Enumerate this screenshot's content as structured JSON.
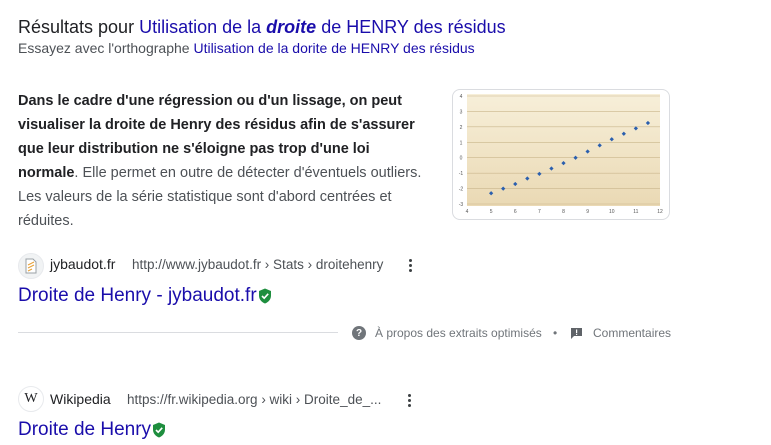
{
  "spelling": {
    "prefix": "Résultats pour",
    "query_part1": "Utilisation de la",
    "query_em": "droite",
    "query_part2": "de HENRY des résidus",
    "suggest_prefix": "Essayez avec l'orthographe",
    "suggest_link": "Utilisation de la dorite de HENRY des résidus"
  },
  "featured_snippet": {
    "bold_text": "Dans le cadre d'une régression ou d'un lissage, on peut visualiser la droite de Henry des résidus afin de s'assurer que leur distribution ne s'éloigne pas trop d'une loi normale",
    "rest_text": ". Elle permet en outre de détecter d'éventuels outliers. Les valeurs de la série statistique sont d'abord centrées et réduites.",
    "thumbnail": {
      "x_ticks": [
        "4",
        "5",
        "6",
        "7",
        "8",
        "9",
        "10",
        "11",
        "12"
      ],
      "y_ticks": [
        "4",
        "3",
        "2",
        "1",
        "0",
        "-1",
        "-2",
        "-3"
      ],
      "points": [
        [
          5,
          -2.3
        ],
        [
          5.5,
          -2.0
        ],
        [
          6,
          -1.7
        ],
        [
          6.5,
          -1.35
        ],
        [
          7,
          -1.05
        ],
        [
          7.5,
          -0.7
        ],
        [
          8,
          -0.35
        ],
        [
          8.5,
          0.0
        ],
        [
          9,
          0.4
        ],
        [
          9.5,
          0.8
        ],
        [
          10,
          1.2
        ],
        [
          10.5,
          1.55
        ],
        [
          11,
          1.9
        ],
        [
          11.5,
          2.25
        ]
      ],
      "point_color": "#2b5fae"
    }
  },
  "result1": {
    "site_name": "jybaudot.fr",
    "url": "http://www.jybaudot.fr › Stats › droitehenry",
    "title": "Droite de Henry - jybaudot.fr"
  },
  "snippet_footer": {
    "about": "À propos des extraits optimisés",
    "separator": "•",
    "feedback": "Commentaires"
  },
  "result2": {
    "favicon_letter": "W",
    "site_name": "Wikipedia",
    "url": "https://fr.wikipedia.org › wiki › Droite_de_...",
    "title": "Droite de Henry"
  },
  "colors": {
    "link": "#1a0dab",
    "verified_shield": "#1e8e3e"
  }
}
